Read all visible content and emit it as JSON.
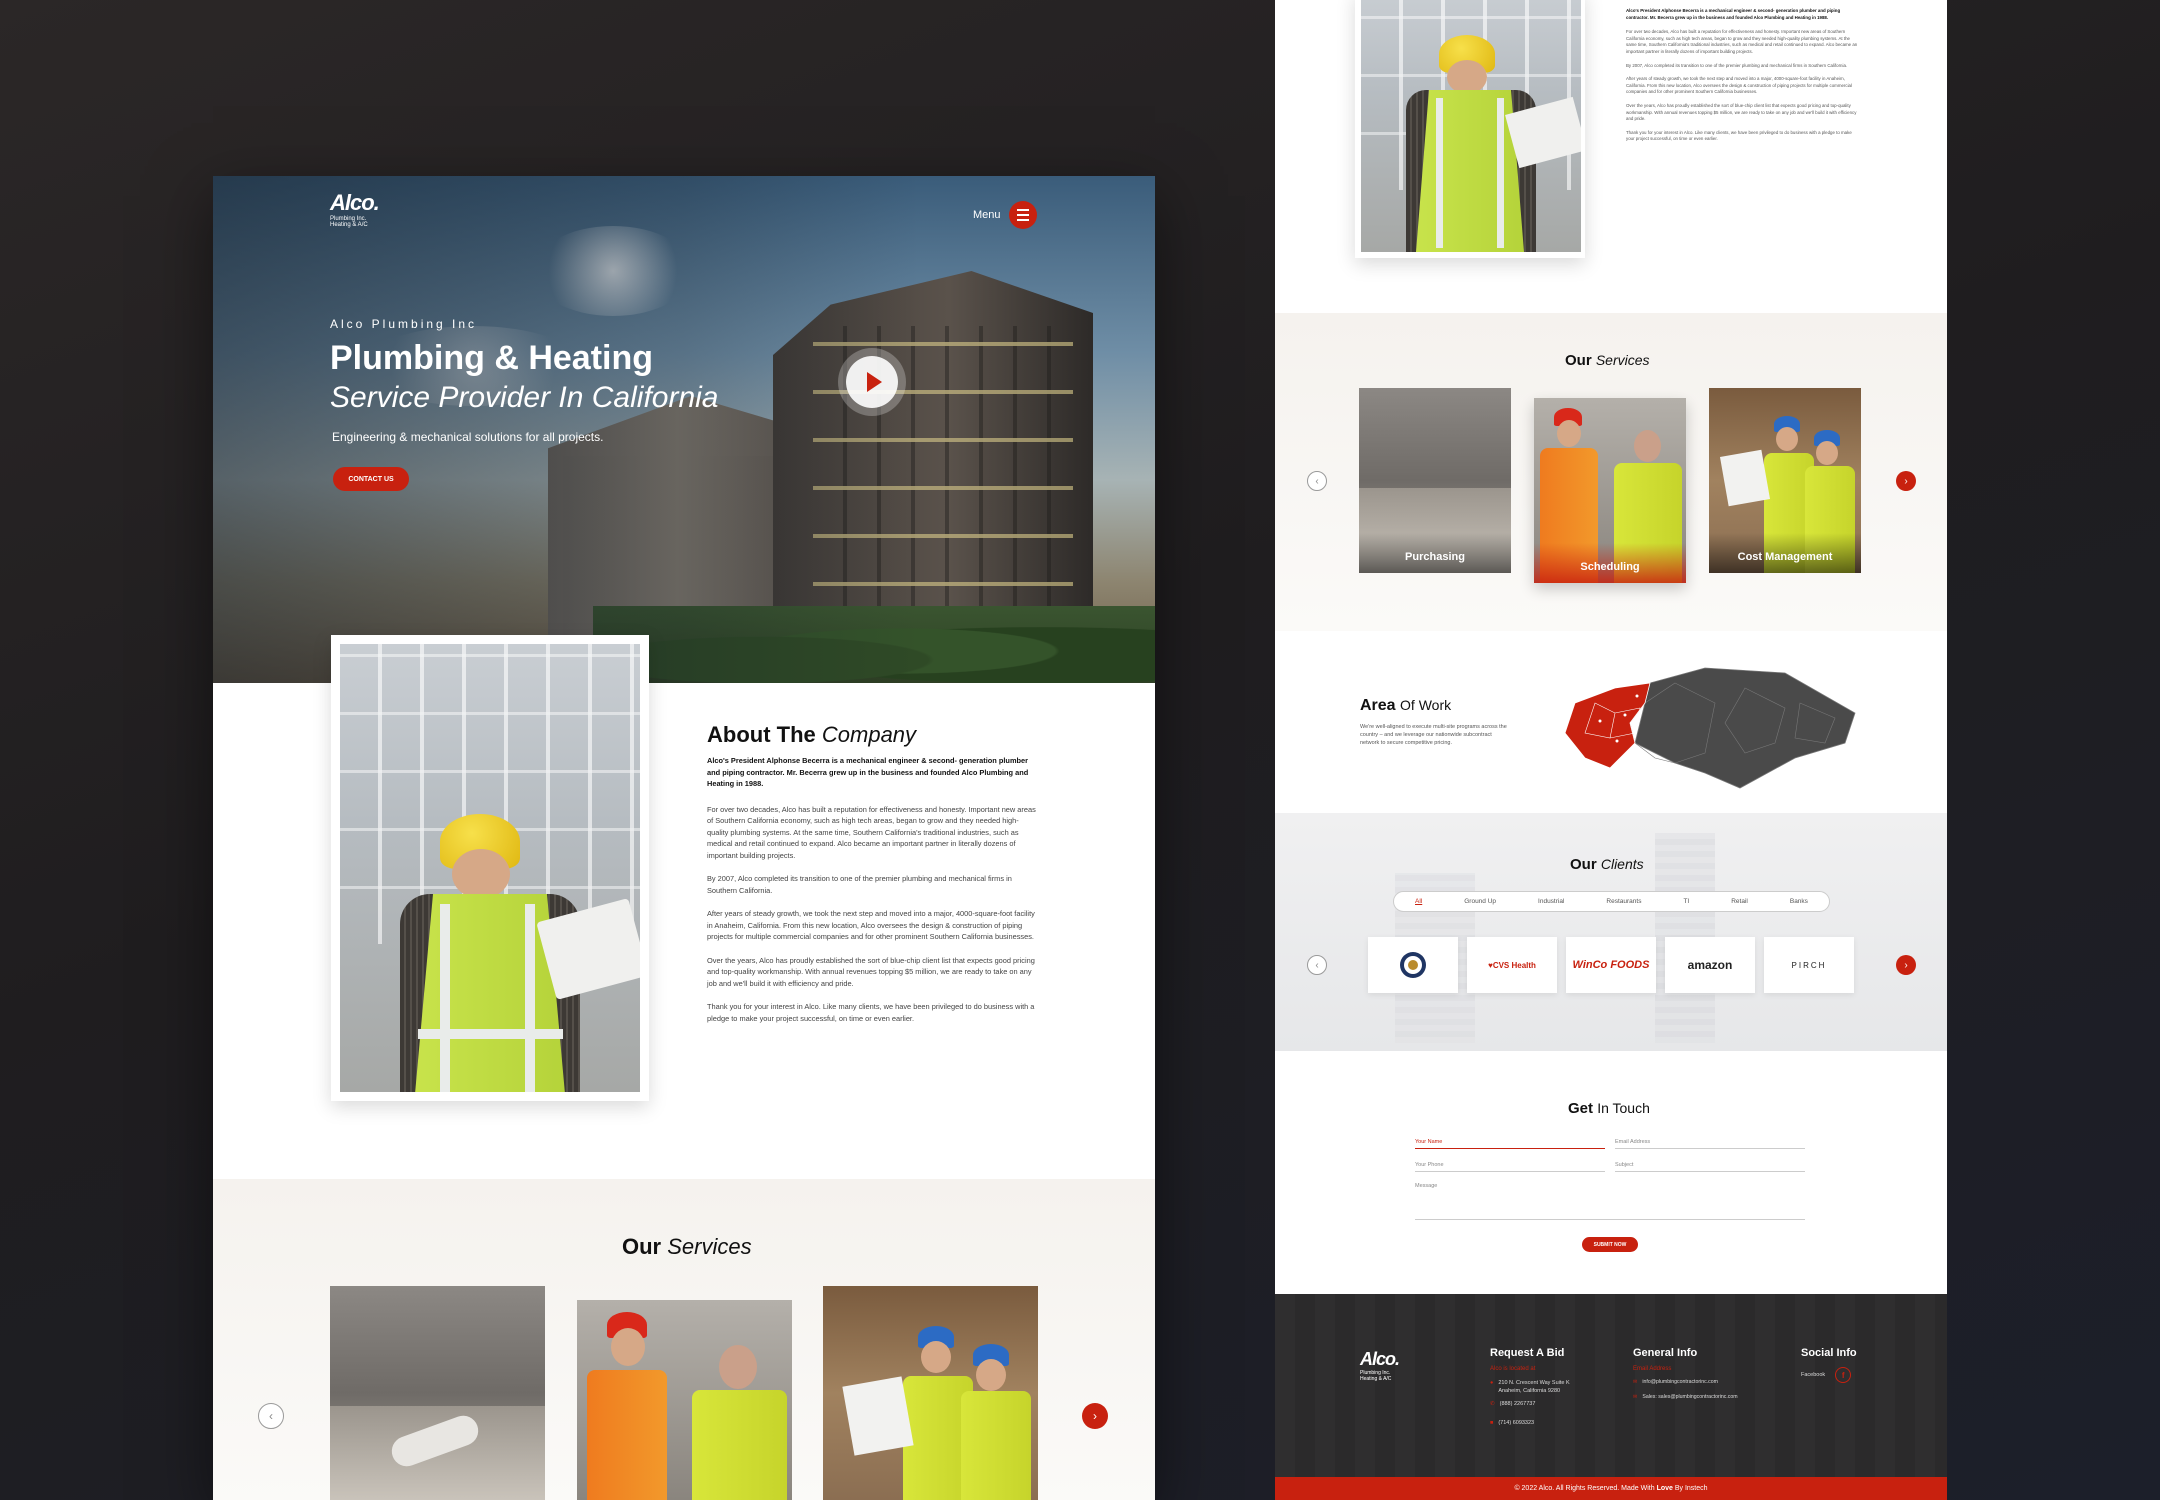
{
  "brand": {
    "logo_main": "Alco.",
    "logo_sub1": "Plumbing Inc.",
    "logo_sub2": "Heating & A/C"
  },
  "nav": {
    "menu_label": "Menu"
  },
  "hero": {
    "kicker": "Alco Plumbing Inc",
    "title": "Plumbing & Heating",
    "subtitle": "Service Provider In California",
    "tagline": "Engineering & mechanical solutions for all projects.",
    "cta": "CONTACT US"
  },
  "about": {
    "title_bold": "About The",
    "title_italic": "Company",
    "lead": "Alco's President Alphonse Becerra is a mechanical engineer & second- generation plumber and piping contractor. Mr. Becerra grew up in the business and founded Alco Plumbing and Heating in 1988.",
    "p1": "For over two decades, Alco has built a reputation for effectiveness and honesty. Important new areas of Southern California economy, such as high tech areas, began to grow and they needed high-quality plumbing systems. At the same time, Southern California's traditional industries, such as medical and retail continued to expand. Alco became an important partner in literally dozens of important building projects.",
    "p2": "By 2007, Alco completed its transition to one of the premier plumbing and mechanical firms in Southern California.",
    "p3": "After years of steady growth, we took the next step and moved into a major, 4000-square-foot facility in Anaheim, California. From this new location, Alco oversees the design & construction of piping projects for multiple commercial companies and for other prominent Southern California businesses.",
    "p4": "Over the years, Alco has proudly established the sort of blue-chip client list that expects good pricing and top-quality workmanship. With annual revenues topping $5 million, we are ready to take on any job and we'll build it with efficiency and pride.",
    "p5": "Thank you for your interest in Alco. Like many clients, we have been privileged to do business with a pledge to make your project successful, on time or even earlier."
  },
  "services": {
    "title_bold": "Our",
    "title_italic": "Services",
    "cards": [
      {
        "label": "Purchasing"
      },
      {
        "label": "Scheduling"
      },
      {
        "label": "Cost Management"
      }
    ]
  },
  "area": {
    "title_bold": "Area",
    "title_rest": "Of Work",
    "text": "We're well-aligned to execute multi-site programs across the country – and we leverage our nationwide subcontract network to secure competitive pricing."
  },
  "clients": {
    "title_bold": "Our",
    "title_italic": "Clients",
    "filters": [
      "All",
      "Ground Up",
      "Industrial",
      "Restaurants",
      "TI",
      "Retail",
      "Banks"
    ],
    "logos": [
      "CVS Health",
      "WinCo FOODS",
      "amazon",
      "PIRCH"
    ]
  },
  "contact": {
    "title_bold": "Get",
    "title_rest": "In Touch",
    "fields": {
      "name": "Your Name",
      "email": "Email Address",
      "phone": "Your Phone",
      "subject": "Subject",
      "message": "Message"
    },
    "submit": "SUBMIT NOW"
  },
  "footer": {
    "bid_title": "Request A Bid",
    "bid_sub": "Alco is located at",
    "address1": "210 N. Crescent Way Suite K",
    "address2": "Anaheim, California 9280",
    "phone1": "(888) 2267737",
    "phone2": "(714) 6093323",
    "info_title": "General Info",
    "info_sub": "Email Address",
    "email1": "info@plumbingcontractorinc.com",
    "email2": "Sales: sales@plumbingcontractorinc.com",
    "social_title": "Social Info",
    "social_fb": "Facebook",
    "copyright_pre": "© 2022 Alco. All Rights Reserved. Made With",
    "copyright_love": "Love",
    "copyright_post": "By Instech"
  },
  "colors": {
    "accent": "#c8210f",
    "dark": "#2b2a2b"
  }
}
